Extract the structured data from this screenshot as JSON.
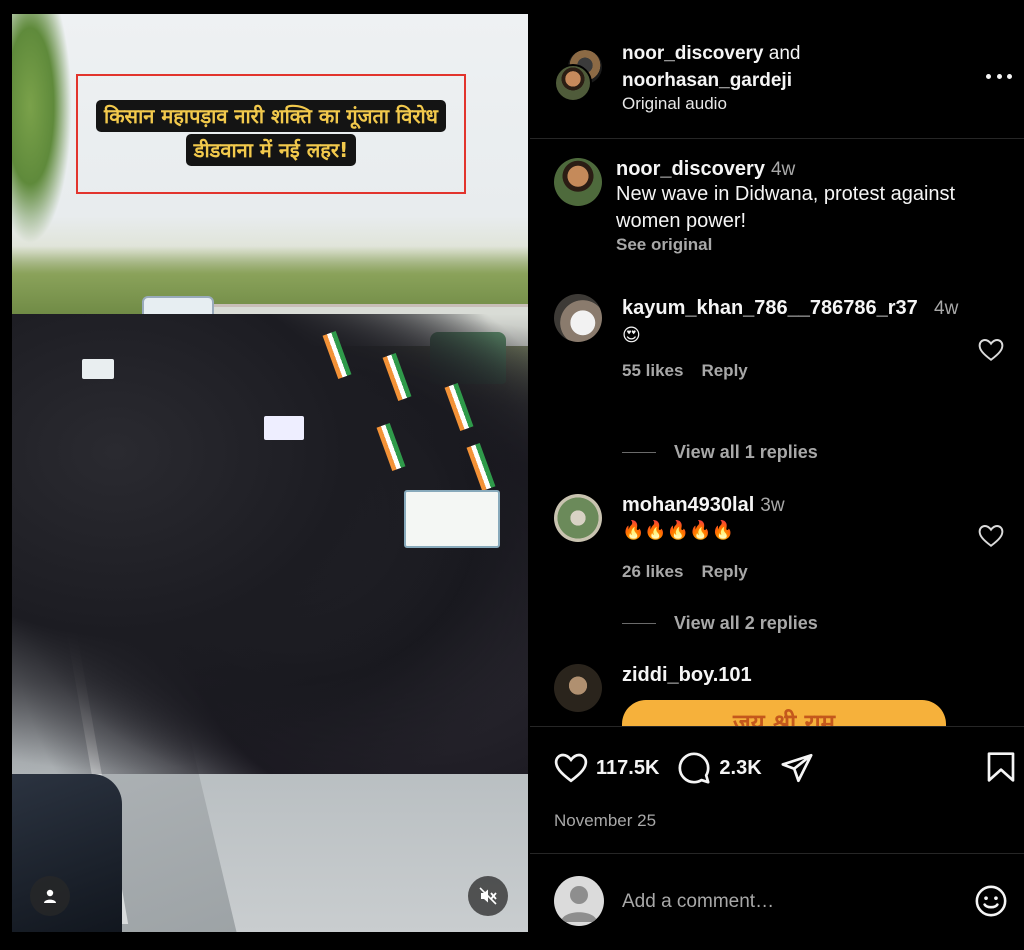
{
  "post": {
    "caption_lines": [
      "किसान महापड़ाव नारी शक्ति का गूंजता विरोध",
      "डीडवाना में नई लहर!"
    ]
  },
  "header": {
    "user1": "noor_discovery",
    "and": "and",
    "user2": "noorhasan_gardeji",
    "audio": "Original audio"
  },
  "caption_comment": {
    "user": "noor_discovery",
    "time": "4w",
    "text": "New wave in Didwana, protest against women power!",
    "see_original": "See original"
  },
  "comments": [
    {
      "user": "kayum_khan_786__786786_r37",
      "time": "4w",
      "text": "😍",
      "likes": "55 likes",
      "reply": "Reply",
      "view_replies": "View all 1 replies"
    },
    {
      "user": "mohan4930lal",
      "time": "3w",
      "text": "🔥🔥🔥🔥🔥",
      "likes": "26 likes",
      "reply": "Reply",
      "view_replies": "View all 2 replies"
    },
    {
      "user": "ziddi_boy.101",
      "pill_text": "जय श्री राम"
    }
  ],
  "actions": {
    "likes": "117.5K",
    "comments": "2.3K",
    "date": "November 25"
  },
  "add_comment": {
    "placeholder": "Add a comment…"
  },
  "icons": [
    "person-icon",
    "mute-icon",
    "more-icon",
    "heart-icon",
    "comment-icon",
    "share-icon",
    "bookmark-icon",
    "emoji-icon"
  ],
  "colors": {
    "background": "#000000",
    "caption_text": "#f2c94c",
    "highlight_box": "#e2342d",
    "secondary_text": "#a8a8a8"
  }
}
